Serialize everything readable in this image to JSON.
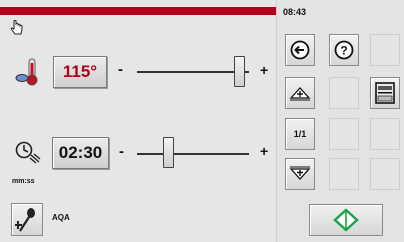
{
  "status": {
    "time": "08:43"
  },
  "temperature": {
    "value": "115°",
    "value_color": "#b3001b",
    "decrease": "-",
    "increase": "+",
    "slider_level": 0.86
  },
  "timer": {
    "value": "02:30",
    "unit_label": "mm:ss",
    "decrease": "-",
    "increase": "+",
    "slider_level": 0.23
  },
  "probe": {
    "label": "AQA"
  },
  "keypad": {
    "one_to_one_label": "1/1"
  },
  "icons": {
    "top_left": "hand-pointer-icon",
    "temperature": "thermometer-icon",
    "timer": "timer-icon",
    "probe": "core-probe-add-icon",
    "back": "back-arrow-icon",
    "help": "help-icon",
    "scroll_up": "scroll-up-icon",
    "scroll_down": "scroll-down-icon",
    "tray": "tray-icon",
    "start": "start-diamond-icon"
  },
  "colors": {
    "accent_red": "#b3001b",
    "start_green": "#1aa24a"
  }
}
